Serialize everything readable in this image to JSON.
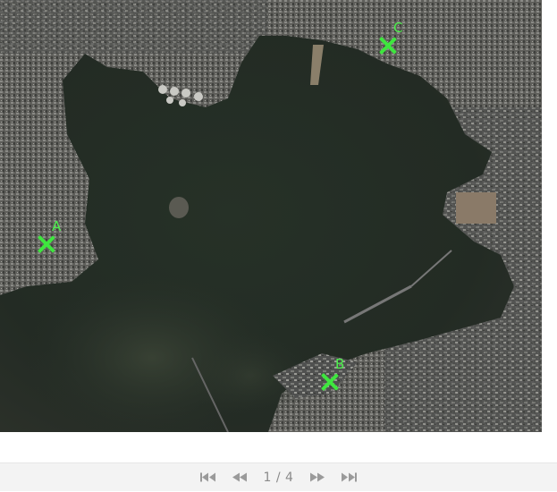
{
  "map": {
    "markers": [
      {
        "id": "A",
        "label": "A"
      },
      {
        "id": "B",
        "label": "B"
      },
      {
        "id": "C",
        "label": "C"
      }
    ],
    "marker_color": "#3ee63e",
    "water_color": "#263126",
    "land_color": "#5c5c58"
  },
  "pager": {
    "current_page": 1,
    "total_pages": 4,
    "counter_text": "1 / 4",
    "buttons": {
      "first_icon": "skip-to-first-icon",
      "prev_icon": "rewind-icon",
      "next_icon": "fast-forward-icon",
      "last_icon": "skip-to-last-icon"
    }
  }
}
